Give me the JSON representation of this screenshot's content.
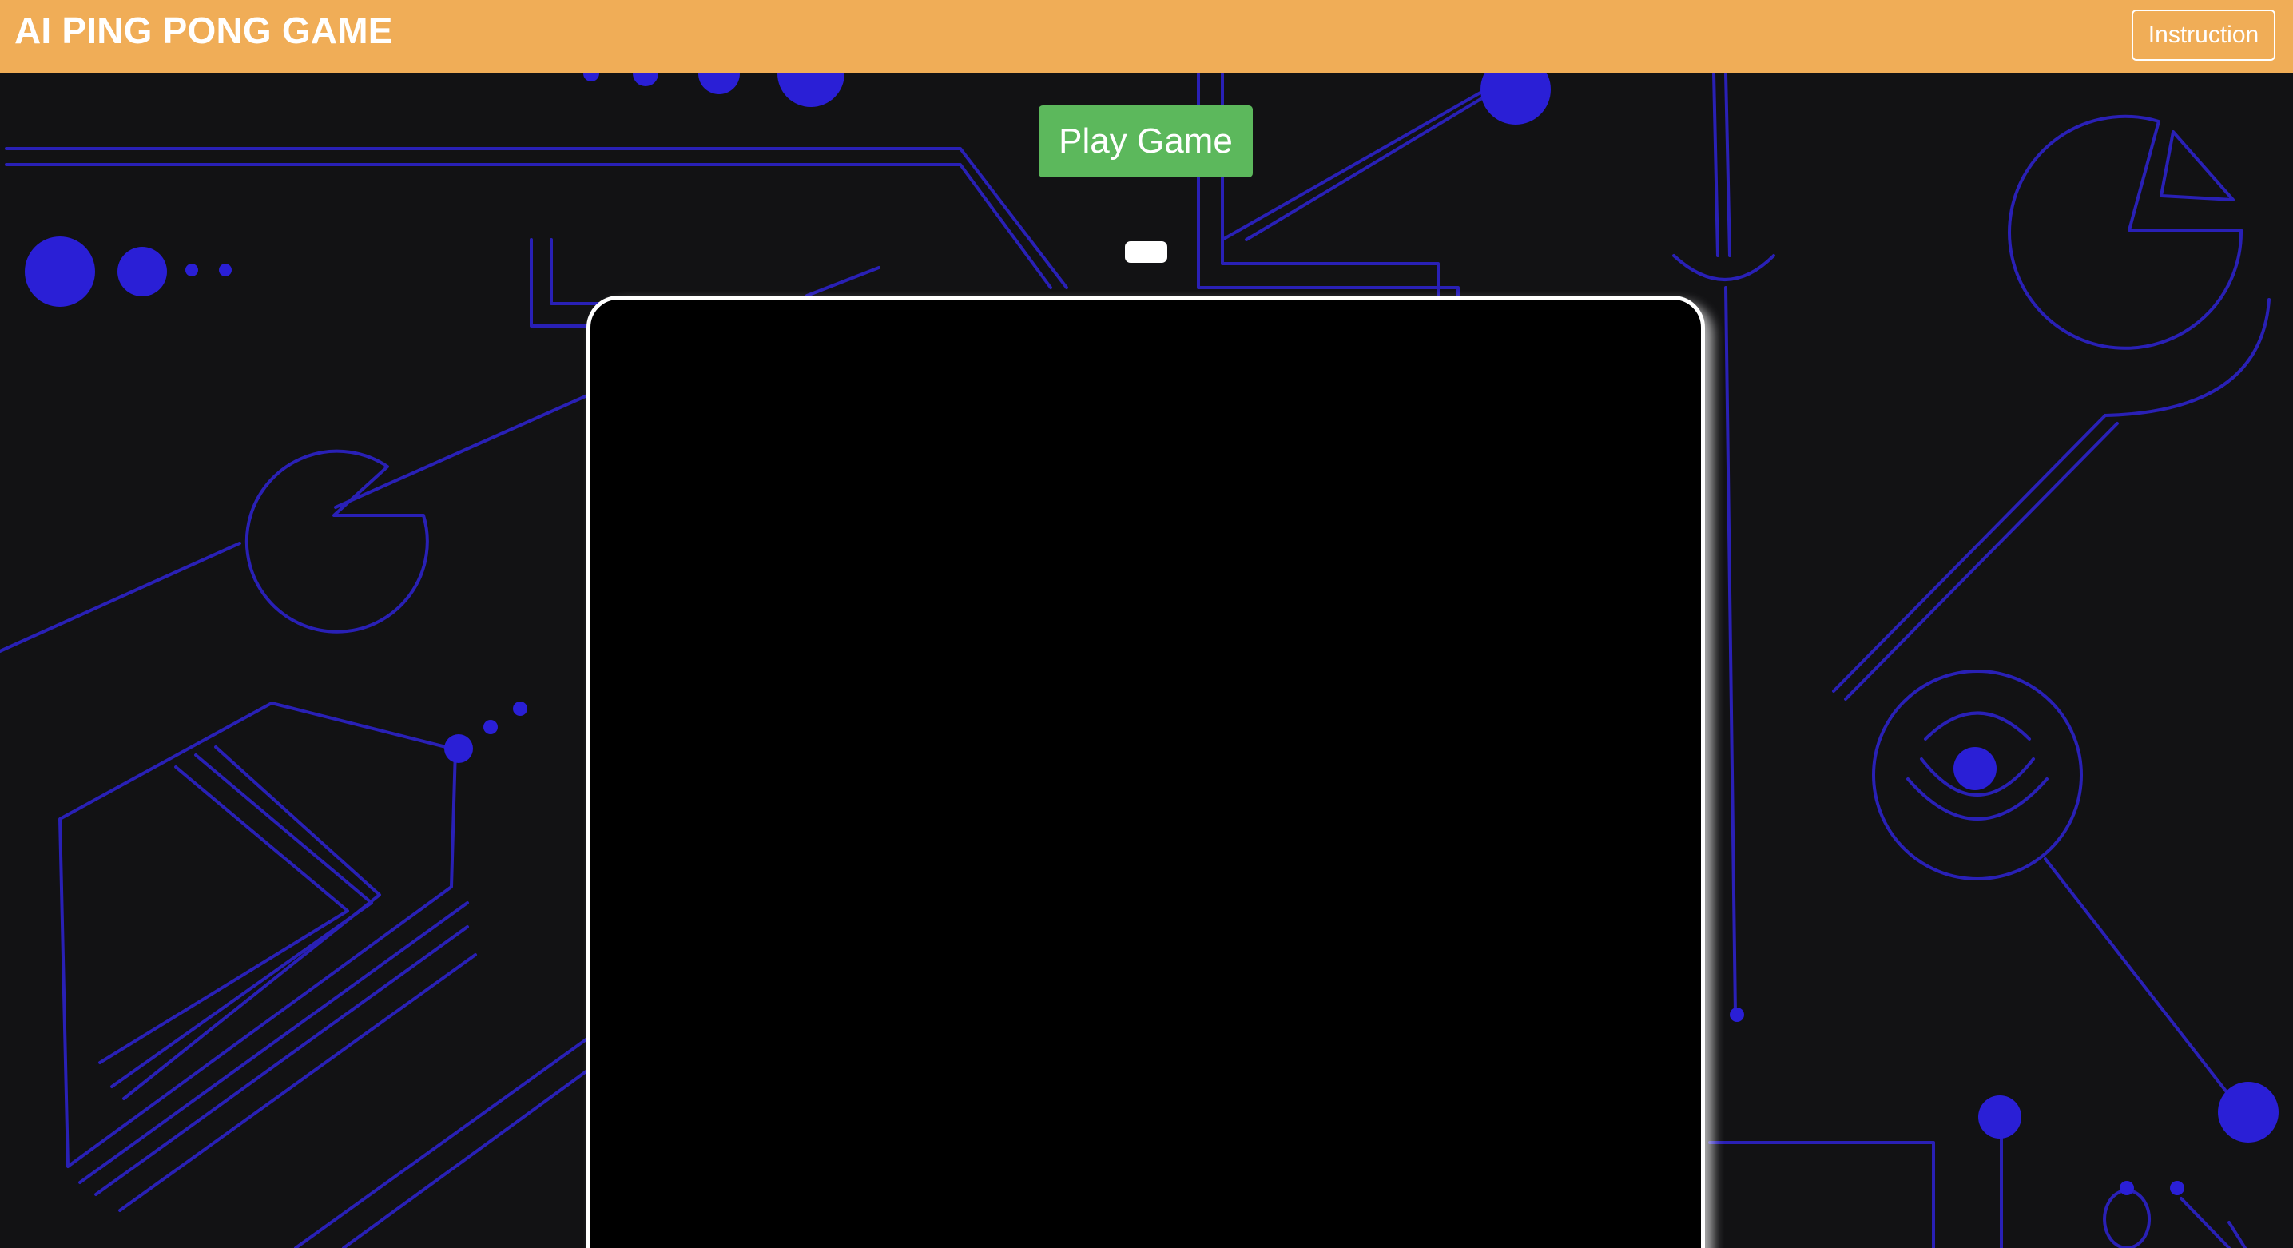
{
  "header": {
    "title": "AI PING PONG GAME",
    "instruction_label": "Instruction"
  },
  "controls": {
    "play_label": "Play Game"
  },
  "colors": {
    "header_bg": "#f0ad57",
    "play_button": "#5cb85c",
    "page_bg": "#121214",
    "board_bg": "#000000",
    "circuit_accent": "#2a1fd6"
  },
  "icons": {
    "ball": "ball-icon"
  }
}
